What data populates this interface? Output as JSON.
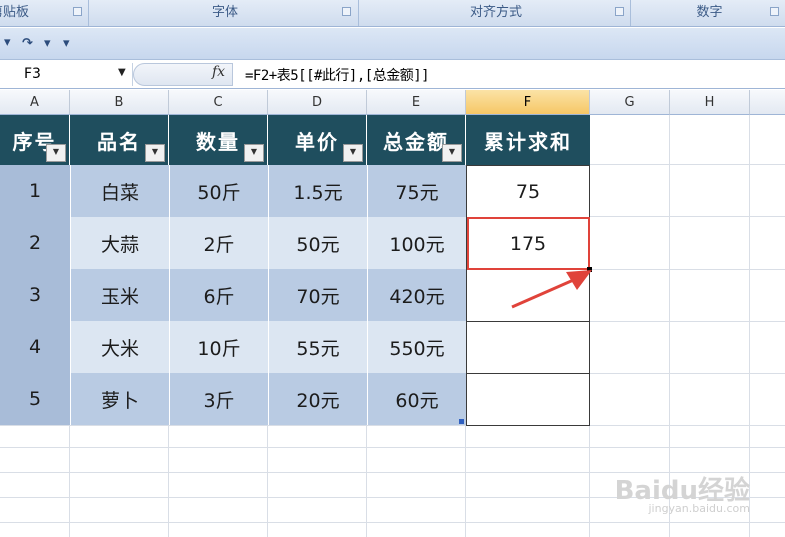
{
  "ribbon": {
    "groups": [
      "剪贴板",
      "字体",
      "对齐方式",
      "数字"
    ]
  },
  "qat": {
    "redo_icon": "↷",
    "dropdown_icon": "▾",
    "customize_icon": "▾"
  },
  "formula_bar": {
    "name_box": "F3",
    "fx_label": "fx",
    "formula": "=F2+表5[[#此行],[总金额]]"
  },
  "columns": [
    "A",
    "B",
    "C",
    "D",
    "E",
    "F",
    "G",
    "H"
  ],
  "table": {
    "headers": [
      "序号",
      "品名",
      "数量",
      "单价",
      "总金额",
      "累计求和"
    ],
    "rows": [
      [
        "1",
        "白菜",
        "50斤",
        "1.5元",
        "75元",
        "75"
      ],
      [
        "2",
        "大蒜",
        "2斤",
        "50元",
        "100元",
        "175"
      ],
      [
        "3",
        "玉米",
        "6斤",
        "70元",
        "420元",
        ""
      ],
      [
        "4",
        "大米",
        "10斤",
        "55元",
        "550元",
        ""
      ],
      [
        "5",
        "萝卜",
        "3斤",
        "20元",
        "60元",
        ""
      ]
    ]
  },
  "colors": {
    "header_bg": "#1f4e5e",
    "selection_border": "#e0433a",
    "arrow": "#e0433a"
  },
  "watermark": {
    "brand": "Baidu经验",
    "url": "jingyan.baidu.com"
  }
}
